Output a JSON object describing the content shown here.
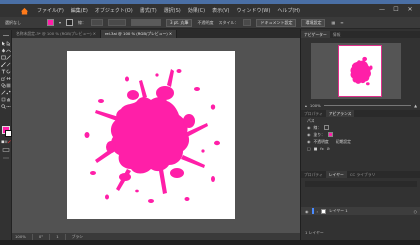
{
  "menubar": {
    "items": [
      "ファイル(F)",
      "編集(E)",
      "オブジェクト(O)",
      "書式(T)",
      "選択(S)",
      "効果(C)",
      "表示(V)",
      "ウィンドウ(W)",
      "ヘルプ(H)"
    ],
    "window_controls": [
      "—",
      "☐",
      "✕"
    ]
  },
  "controlbar": {
    "selection_label": "選択なし",
    "stroke_label": "線：",
    "brush_label": "3 pt. 丸筆",
    "opacity_label": "不透明度",
    "style_label": "スタイル：",
    "doc_settings_button": "ドキュメント設定",
    "prefs_button": "環境設定"
  },
  "tabs": [
    {
      "label": "名称未設定-3* @ 100 % (RGB/プレビュー)",
      "active": false
    },
    {
      "label": "rel.3ai @ 100 % (RGB/プレビュー)",
      "active": true
    }
  ],
  "statusbar": {
    "zoom": "100%",
    "rotation": "0°",
    "page": "1",
    "tool": "ブラシ"
  },
  "navigator": {
    "tabs": [
      "ナビゲーター",
      "情報"
    ],
    "zoom": "100%"
  },
  "appearance": {
    "tabs": [
      "プロパティ",
      "アピアランス"
    ],
    "rows": [
      "パス",
      "線：",
      "塗り：",
      "不透明度",
      "初期設定"
    ]
  },
  "layers": {
    "tabs": [
      "プロパティ",
      "レイヤー",
      "CC ライブラリ"
    ],
    "layer_name": "レイヤー 1",
    "footer": "1 レイヤー"
  },
  "colors": {
    "fill": "#ff1fa8",
    "accent": "#e0308c"
  }
}
